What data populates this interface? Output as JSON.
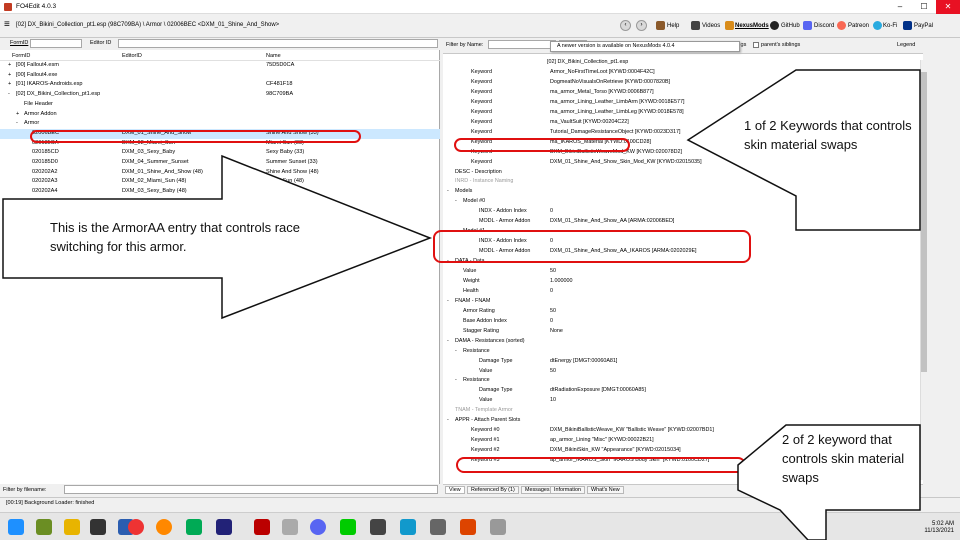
{
  "window": {
    "title": "FO4Edit 4.0.3"
  },
  "toolbar": {
    "path": "[02] DX_Bikini_Collection_pt1.esp (98C709BA) \\ Armor \\ 02006BEC <DXM_01_Shine_And_Show>",
    "links": [
      "Help",
      "Videos",
      "NexusMods",
      "GitHub",
      "Discord",
      "Patreon",
      "Ko-Fi",
      "PayPal"
    ]
  },
  "left": {
    "formid_label": "FormID",
    "editorid_label": "Editor ID",
    "columns": [
      "FormID",
      "EditorID",
      "Name"
    ],
    "rows": [
      {
        "formid": "[00] Fallout4.esm",
        "editorid": "",
        "name": "75D5D0CA",
        "indent": 1,
        "expander": "+"
      },
      {
        "formid": "[00] Fallout4.exe",
        "editorid": "",
        "name": "",
        "indent": 1,
        "expander": "+"
      },
      {
        "formid": "[01] IKAROS-Androids.esp",
        "editorid": "",
        "name": "CF481F18",
        "indent": 1,
        "expander": "+"
      },
      {
        "formid": "[02] DX_Bikini_Collection_pt1.esp",
        "editorid": "",
        "name": "98C709BA",
        "indent": 1,
        "expander": "-"
      },
      {
        "formid": "File Header",
        "editorid": "",
        "name": "",
        "indent": 2,
        "expander": ""
      },
      {
        "formid": "Armor Addon",
        "editorid": "",
        "name": "",
        "indent": 2,
        "expander": "+"
      },
      {
        "formid": "Armor",
        "editorid": "",
        "name": "",
        "indent": 2,
        "expander": "-"
      },
      {
        "formid": "02006BEC",
        "editorid": "DXM_01_Shine_And_Show",
        "name": "Shine And Show (33)",
        "indent": 3,
        "expander": "",
        "selected": true
      },
      {
        "formid": "020185CA",
        "editorid": "DXM_02_Miami_Sun",
        "name": "Miami Sun (33)",
        "indent": 3,
        "expander": ""
      },
      {
        "formid": "020185CD",
        "editorid": "DXM_03_Sexy_Baby",
        "name": "Sexy Baby (33)",
        "indent": 3,
        "expander": ""
      },
      {
        "formid": "020185D0",
        "editorid": "DXM_04_Summer_Sunset",
        "name": "Summer Sunset (33)",
        "indent": 3,
        "expander": ""
      },
      {
        "formid": "020202A2",
        "editorid": "DXM_01_Shine_And_Show (48)",
        "name": "Shine And Show (48)",
        "indent": 3,
        "expander": ""
      },
      {
        "formid": "020202A3",
        "editorid": "DXM_02_Miami_Sun (48)",
        "name": "Miami Sun (48)",
        "indent": 3,
        "expander": ""
      },
      {
        "formid": "020202A4",
        "editorid": "DXM_03_Sexy_Baby (48)",
        "name": "",
        "indent": 3,
        "expander": ""
      }
    ],
    "filter_label": "Filter by filename:"
  },
  "right": {
    "filter_label": "Filter by Name:",
    "filter_op": "and",
    "filter_by": "by",
    "siblings": "siblings",
    "parent_siblings": "parent's siblings",
    "legend": "Legend",
    "notification": "A newer version is available on NexusMods 4.0.4",
    "header_file": "[02] DX_Bikini_Collection_pt1.esp",
    "rows": [
      {
        "label": "Keyword",
        "value": "Armor_NoFirstTimeLoot [KYWD:0004F42C]",
        "indent": 3
      },
      {
        "label": "Keyword",
        "value": "DogmeatNoVisualsOnRetrieve [KYWD:0007820B]",
        "indent": 3
      },
      {
        "label": "Keyword",
        "value": "ma_armor_Metal_Torso [KYWD:0006B877]",
        "indent": 3
      },
      {
        "label": "Keyword",
        "value": "ma_armor_Lining_Leather_LimbArm [KYWD:0018E577]",
        "indent": 3
      },
      {
        "label": "Keyword",
        "value": "ma_armor_Lining_Leather_LimbLeg [KYWD:0018E578]",
        "indent": 3
      },
      {
        "label": "Keyword",
        "value": "ma_VaultSuit [KYWD:00204C22]",
        "indent": 3
      },
      {
        "label": "Keyword",
        "value": "Tutorial_DamageResistanceObject [KYWD:0023D317]",
        "indent": 3
      },
      {
        "label": "Keyword",
        "value": "ma_IKAROS_Material [KYWD:0100CD28]",
        "indent": 3
      },
      {
        "label": "Keyword",
        "value": "DXM_BikiniBallisticWeaveMod_KW [KYWD:020078D2]",
        "indent": 3
      },
      {
        "label": "Keyword",
        "value": "DXM_01_Shine_And_Show_Skin_Mod_KW [KYWD:02015035]",
        "indent": 3
      },
      {
        "label": "DESC - Description",
        "value": "",
        "indent": 1
      },
      {
        "label": "INRD - Instance Naming",
        "value": "",
        "indent": 1,
        "grey": true
      },
      {
        "label": "Models",
        "value": "",
        "indent": 1,
        "expander": "-"
      },
      {
        "label": "Model #0",
        "value": "",
        "indent": 2,
        "expander": "-"
      },
      {
        "label": "INDX - Addon Index",
        "value": "0",
        "indent": 4
      },
      {
        "label": "MODL - Armor Addon",
        "value": "DXM_01_Shine_And_Show_AA [ARMA:02006BED]",
        "indent": 4
      },
      {
        "label": "Model #1",
        "value": "",
        "indent": 2,
        "expander": "-"
      },
      {
        "label": "INDX - Addon Index",
        "value": "0",
        "indent": 4
      },
      {
        "label": "MODL - Armor Addon",
        "value": "DXM_01_Shine_And_Show_AA_IKAROS [ARMA:0202029E]",
        "indent": 4
      },
      {
        "label": "DATA - Data",
        "value": "",
        "indent": 1,
        "expander": "-"
      },
      {
        "label": "Value",
        "value": "50",
        "indent": 2
      },
      {
        "label": "Weight",
        "value": "1.000000",
        "indent": 2
      },
      {
        "label": "Health",
        "value": "0",
        "indent": 2
      },
      {
        "label": "FNAM - FNAM",
        "value": "",
        "indent": 1,
        "expander": "-"
      },
      {
        "label": "Armor Rating",
        "value": "50",
        "indent": 2
      },
      {
        "label": "Base Addon Index",
        "value": "0",
        "indent": 2
      },
      {
        "label": "Stagger Rating",
        "value": "None",
        "indent": 2
      },
      {
        "label": "DAMA - Resistances (sorted)",
        "value": "",
        "indent": 1,
        "expander": "-"
      },
      {
        "label": "Resistance",
        "value": "",
        "indent": 2,
        "expander": "-"
      },
      {
        "label": "Damage Type",
        "value": "dtEnergy [DMGT:00060A81]",
        "indent": 4
      },
      {
        "label": "Value",
        "value": "50",
        "indent": 4
      },
      {
        "label": "Resistance",
        "value": "",
        "indent": 2,
        "expander": "-"
      },
      {
        "label": "Damage Type",
        "value": "dtRadiationExposure [DMGT:00060A85]",
        "indent": 4
      },
      {
        "label": "Value",
        "value": "10",
        "indent": 4
      },
      {
        "label": "TNAM - Template Armor",
        "value": "",
        "indent": 1,
        "grey": true
      },
      {
        "label": "APPR - Attach Parent Slots",
        "value": "",
        "indent": 1,
        "expander": "-"
      },
      {
        "label": "Keyword #0",
        "value": "DXM_BikiniBallisticWeave_KW \"Ballistic Weave\" [KYWD:02007BD1]",
        "indent": 3
      },
      {
        "label": "Keyword #1",
        "value": "ap_armor_Lining \"Misc\" [KYWD:00022B21]",
        "indent": 3
      },
      {
        "label": "Keyword #2",
        "value": "DXM_BikiniSkin_KW \"Appearance\" [KYWD:02015034]",
        "indent": 3
      },
      {
        "label": "Keyword #3",
        "value": "ap_armor_IKAROS_Skin \"IKAROS Body Skin\" [KYWD:0100CD27]",
        "indent": 3
      }
    ],
    "tabs": [
      "View",
      "Referenced By (1)",
      "Messages",
      "Information",
      "What's New"
    ]
  },
  "status": {
    "text": "[00:19] Background Loader: finished"
  },
  "clock": {
    "time": "5:02 AM",
    "date": "11/13/2021"
  },
  "annotations": {
    "left_arrow_text": "This is the ArmorAA entry that controls race switching for this armor.",
    "top_arrow_text": "1 of 2 Keywords that controls skin material swaps",
    "bottom_arrow_text": "2 of 2 keyword that controls skin material swaps"
  },
  "colors": {
    "accent_red": "#e01010",
    "selection": "#cce8ff",
    "arrow_fill": "#ffffff"
  }
}
